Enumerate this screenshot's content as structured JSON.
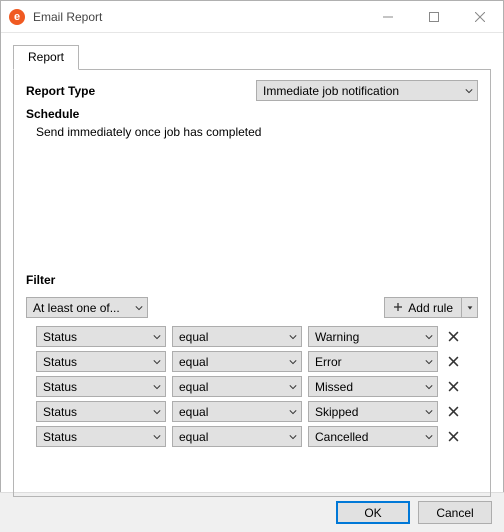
{
  "window": {
    "title": "Email Report"
  },
  "tab": {
    "label": "Report"
  },
  "report": {
    "type_label": "Report Type",
    "type_value": "Immediate job notification",
    "schedule_label": "Schedule",
    "schedule_text": "Send immediately once job has completed"
  },
  "filter": {
    "label": "Filter",
    "condition": "At least one of...",
    "add_rule": "Add rule",
    "rules": [
      {
        "field": "Status",
        "op": "equal",
        "val": "Warning"
      },
      {
        "field": "Status",
        "op": "equal",
        "val": "Error"
      },
      {
        "field": "Status",
        "op": "equal",
        "val": "Missed"
      },
      {
        "field": "Status",
        "op": "equal",
        "val": "Skipped"
      },
      {
        "field": "Status",
        "op": "equal",
        "val": "Cancelled"
      }
    ]
  },
  "buttons": {
    "ok": "OK",
    "cancel": "Cancel"
  }
}
